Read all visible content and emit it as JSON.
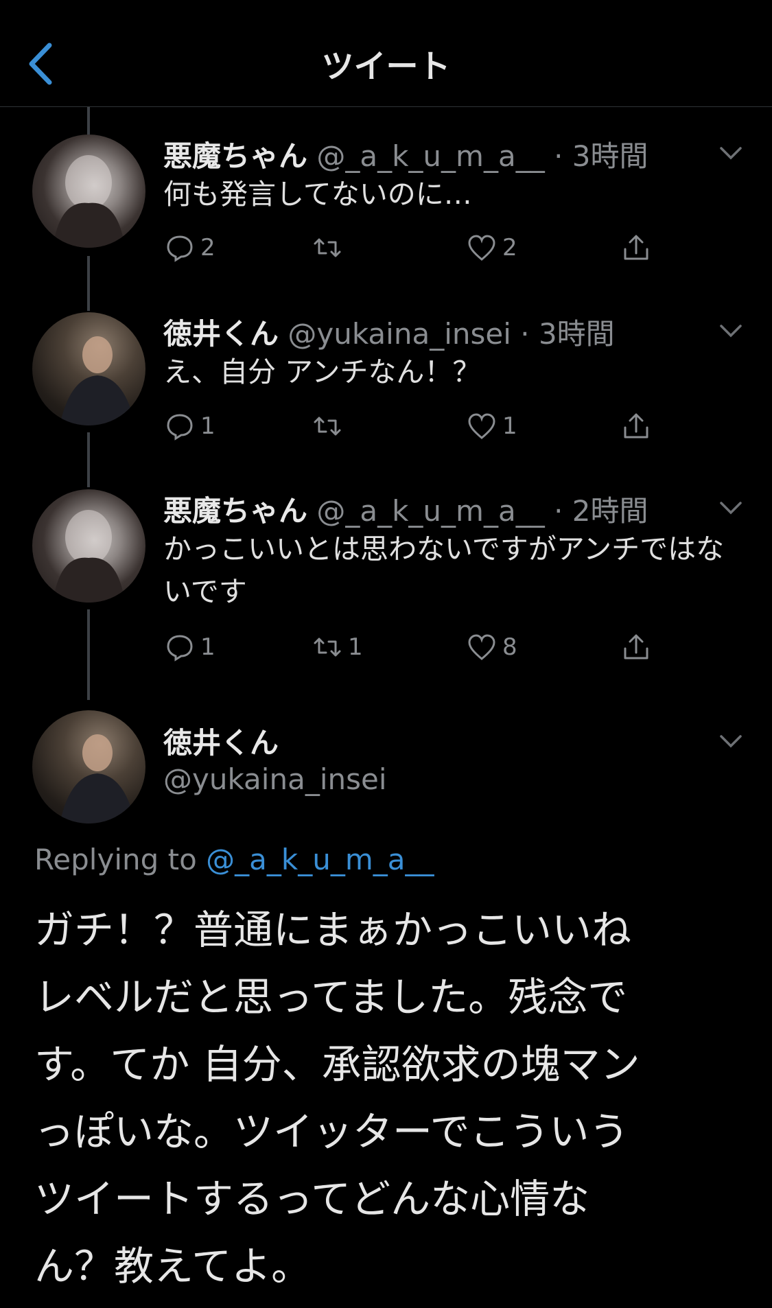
{
  "header": {
    "title": "ツイート",
    "back_icon": "chevron-left-icon"
  },
  "tweets": [
    {
      "name": "悪魔ちゃん",
      "handle": "@_a_k_u_m_a__",
      "time": "3時間",
      "text": "何も発言してないのに…",
      "replies": "2",
      "retweets": "",
      "likes": "2"
    },
    {
      "name": "徳井くん",
      "handle": "@yukaina_insei",
      "time": "3時間",
      "text": "え、自分 アンチなん！？",
      "replies": "1",
      "retweets": "",
      "likes": "1"
    },
    {
      "name": "悪魔ちゃん",
      "handle": "@_a_k_u_m_a__",
      "time": "2時間",
      "text": "かっこいいとは思わないですがアンチではないです",
      "replies": "1",
      "retweets": "1",
      "likes": "8"
    }
  ],
  "main_tweet": {
    "name": "徳井くん",
    "handle": "@yukaina_insei",
    "replying_prefix": "Replying to",
    "replying_to": "@_a_k_u_m_a__",
    "lines": [
      "ガチ！？普通にまぁかっこいいね",
      "レベルだと思ってました。残念で",
      "す。てか 自分、承認欲求の塊マン",
      "っぽいな。ツイッターでこういう",
      "ツイートするってどんな心情な",
      "ん？教えてよ。"
    ]
  },
  "colors": {
    "background": "#000000",
    "accent": "#3a8fd6",
    "muted": "#8a8d91"
  }
}
